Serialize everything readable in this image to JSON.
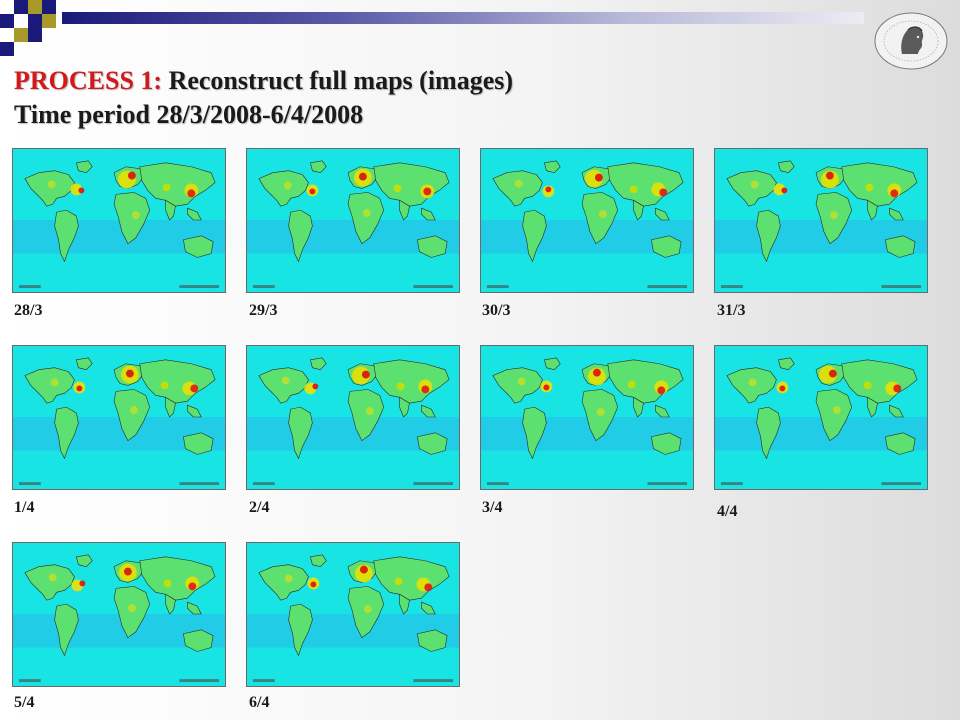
{
  "header": {
    "title_prefix": "PROCESS 1:",
    "title_main": " Reconstruct full maps (images)",
    "subtitle": "Time period 28/3/2008-6/4/2008"
  },
  "colors": {
    "accent": "#d21a1a",
    "navy": "#1a1a7a",
    "olive": "#a89a28",
    "map_ocean": "#16e0e0"
  },
  "maps": [
    {
      "caption": "28/3"
    },
    {
      "caption": "29/3"
    },
    {
      "caption": "30/3"
    },
    {
      "caption": "31/3"
    },
    {
      "caption": "1/4"
    },
    {
      "caption": "2/4"
    },
    {
      "caption": "3/4"
    },
    {
      "caption": "4/4"
    },
    {
      "caption": "5/4"
    },
    {
      "caption": "6/4"
    }
  ]
}
